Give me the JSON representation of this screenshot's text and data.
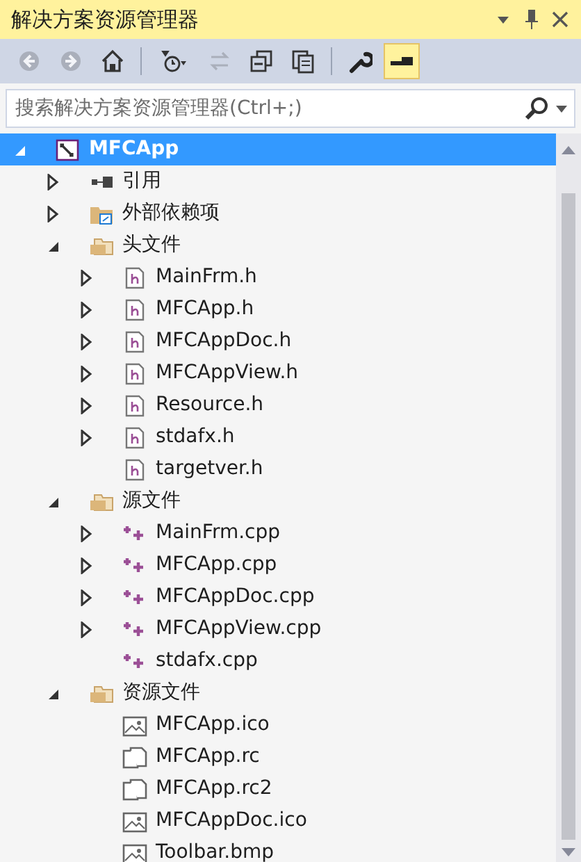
{
  "window": {
    "title": "解决方案资源管理器"
  },
  "toolbar": [
    {
      "kind": "back",
      "disabled": true,
      "selected": false
    },
    {
      "kind": "forward",
      "disabled": true,
      "selected": false
    },
    {
      "kind": "home",
      "disabled": false,
      "selected": false
    },
    {
      "kind": "history",
      "disabled": false,
      "selected": false
    },
    {
      "kind": "sync",
      "disabled": true,
      "selected": false
    },
    {
      "kind": "collapse",
      "disabled": false,
      "selected": false
    },
    {
      "kind": "pages",
      "disabled": false,
      "selected": false
    },
    {
      "kind": "wrench",
      "disabled": false,
      "selected": false
    },
    {
      "kind": "preview",
      "disabled": false,
      "selected": true
    }
  ],
  "search": {
    "placeholder": "搜索解决方案资源管理器(Ctrl+;)"
  },
  "tree": [
    {
      "label": "MFCApp",
      "kind": "project",
      "expanded": true,
      "selected": true,
      "children": [
        {
          "label": "引用",
          "kind": "references",
          "expanded": false,
          "selected": false
        },
        {
          "label": "外部依赖项",
          "kind": "external",
          "expanded": false,
          "selected": false
        },
        {
          "label": "头文件",
          "kind": "folder",
          "expanded": true,
          "selected": false,
          "children": [
            {
              "label": "MainFrm.h",
              "kind": "h",
              "expanded": false,
              "selected": false
            },
            {
              "label": "MFCApp.h",
              "kind": "h",
              "expanded": false,
              "selected": false
            },
            {
              "label": "MFCAppDoc.h",
              "kind": "h",
              "expanded": false,
              "selected": false
            },
            {
              "label": "MFCAppView.h",
              "kind": "h",
              "expanded": false,
              "selected": false
            },
            {
              "label": "Resource.h",
              "kind": "h",
              "expanded": false,
              "selected": false
            },
            {
              "label": "stdafx.h",
              "kind": "h",
              "expanded": false,
              "selected": false
            },
            {
              "label": "targetver.h",
              "kind": "h",
              "selected": false
            }
          ]
        },
        {
          "label": "源文件",
          "kind": "folder",
          "expanded": true,
          "selected": false,
          "children": [
            {
              "label": "MainFrm.cpp",
              "kind": "cpp",
              "expanded": false,
              "selected": false
            },
            {
              "label": "MFCApp.cpp",
              "kind": "cpp",
              "expanded": false,
              "selected": false
            },
            {
              "label": "MFCAppDoc.cpp",
              "kind": "cpp",
              "expanded": false,
              "selected": false
            },
            {
              "label": "MFCAppView.cpp",
              "kind": "cpp",
              "expanded": false,
              "selected": false
            },
            {
              "label": "stdafx.cpp",
              "kind": "cpp",
              "selected": false
            }
          ]
        },
        {
          "label": "资源文件",
          "kind": "folder",
          "expanded": true,
          "selected": false,
          "children": [
            {
              "label": "MFCApp.ico",
              "kind": "image",
              "selected": false
            },
            {
              "label": "MFCApp.rc",
              "kind": "rc",
              "selected": false
            },
            {
              "label": "MFCApp.rc2",
              "kind": "rc",
              "selected": false
            },
            {
              "label": "MFCAppDoc.ico",
              "kind": "image",
              "selected": false
            },
            {
              "label": "Toolbar.bmp",
              "kind": "image",
              "selected": false
            }
          ]
        }
      ]
    }
  ]
}
